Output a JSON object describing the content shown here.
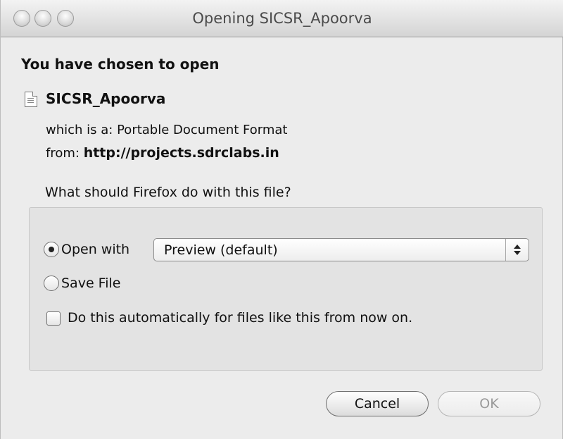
{
  "window": {
    "title": "Opening SICSR_Apoorva"
  },
  "dialog": {
    "heading": "You have chosen to open",
    "file_name": "SICSR_Apoorva",
    "type_label": "which is a:",
    "type_value": "Portable Document Format",
    "from_label": "from:",
    "from_value": "http://projects.sdrclabs.in",
    "question": "What should Firefox do with this file?"
  },
  "options": {
    "open_with_label": "Open with",
    "open_with_selected": true,
    "open_with_app": "Preview (default)",
    "save_file_label": "Save File",
    "save_file_selected": false,
    "auto_label": "Do this automatically for files like this from now on.",
    "auto_checked": false
  },
  "buttons": {
    "cancel": "Cancel",
    "ok": "OK",
    "ok_enabled": false
  }
}
